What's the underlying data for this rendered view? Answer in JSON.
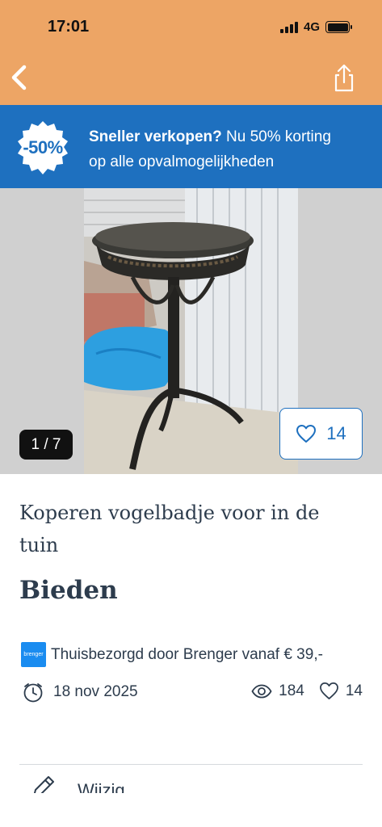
{
  "status_bar": {
    "time": "17:01",
    "network": "4G"
  },
  "nav": {
    "back_icon": "chevron-left-icon",
    "share_icon": "share-icon"
  },
  "promo": {
    "badge": "-50%",
    "headline": "Sneller verkopen?",
    "body_line1": " Nu 50% korting",
    "body_line2": "op alle opvalmogelijkheden"
  },
  "gallery": {
    "counter": "1 / 7",
    "favorite_count": "14"
  },
  "listing": {
    "title": "Koperen vogelbadje voor in de tuin",
    "price": "Bieden",
    "delivery_logo": "brenger",
    "delivery_text": "Thuisbezorgd door Brenger vanaf € 39,-",
    "date": "18 nov 2025",
    "views": "184",
    "likes": "14"
  },
  "actions": {
    "edit_label": "Wijzig"
  },
  "colors": {
    "header": "#eda565",
    "promo": "#1e70bf",
    "text": "#2d3c4d",
    "accent": "#1e70bf"
  }
}
